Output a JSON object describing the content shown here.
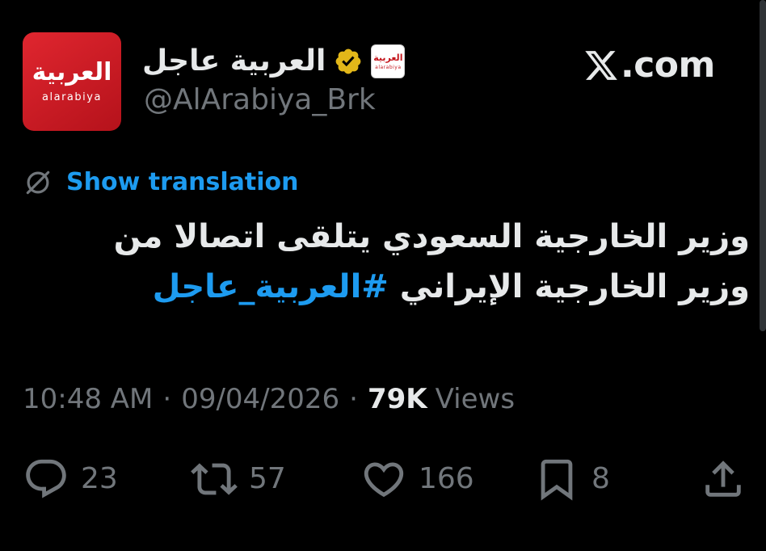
{
  "account": {
    "avatar_logo_arabic": "العربية",
    "avatar_logo_latin": "alarabiya",
    "display_name": "العربية عاجل",
    "handle": "@AlArabiya_Brk",
    "affiliate_logo_arabic": "العربية",
    "affiliate_logo_latin": "alarabiya"
  },
  "brand": {
    "site": ".com"
  },
  "translation": {
    "label": "Show translation"
  },
  "tweet": {
    "line1": "وزير الخارجية السعودي يتلقى اتصالا من",
    "line2": "وزير الخارجية الإيراني",
    "hashtag": "#العربية_عاجل"
  },
  "meta": {
    "time": "10:48 AM",
    "separator": "·",
    "date": "09/04/2026",
    "views_count": "79K",
    "views_label": "Views"
  },
  "actions": {
    "replies": "23",
    "reposts": "57",
    "likes": "166",
    "bookmarks": "8"
  },
  "colors": {
    "background": "#000000",
    "text_primary": "#e7e9ea",
    "text_secondary": "#71767b",
    "accent_blue": "#1d9bf0",
    "verified_gold": "#e2b719",
    "brand_red": "#d71920"
  }
}
